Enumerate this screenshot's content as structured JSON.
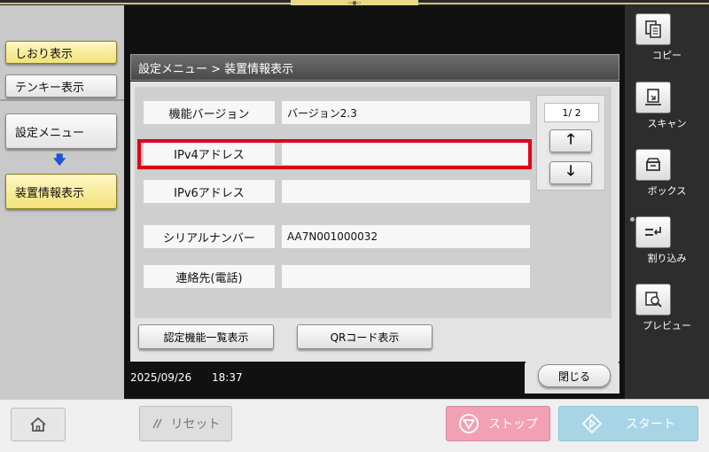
{
  "top_handle": "‹‹●››",
  "left_panel": {
    "bookmark_label": "しおり表示",
    "tenkey_label": "テンキー表示",
    "settings_menu_label": "設定メニュー",
    "device_info_label": "装置情報表示"
  },
  "dialog": {
    "breadcrumb": "設定メニュー > 装置情報表示",
    "rows": [
      {
        "label": "機能バージョン",
        "value": "バージョン2.3"
      },
      {
        "label": "IPv4アドレス",
        "value": ""
      },
      {
        "label": "IPv6アドレス",
        "value": ""
      },
      {
        "label": "シリアルナンバー",
        "value": "AA7N001000032"
      },
      {
        "label": "連絡先(電話)",
        "value": ""
      }
    ],
    "page_indicator": "1/ 2",
    "up_arrow": "🡑",
    "down_arrow": "🡓",
    "cert_list_button": "認定機能一覧表示",
    "qr_button": "QRコード表示",
    "close_button": "閉じる"
  },
  "status": {
    "date": "2025/09/26",
    "time": "18:37"
  },
  "right_panel": {
    "copy_label": "コピー",
    "scan_label": "スキャン",
    "box_label": "ボックス",
    "interrupt_label": "割り込み",
    "preview_label": "プレビュー"
  },
  "bottom_bar": {
    "reset_label": "リセット",
    "stop_label": "ストップ",
    "start_label": "スタート"
  },
  "colors": {
    "highlight": "#e0001a",
    "active_tab": "#f2e27a",
    "stop": "#f1a1b3",
    "start": "#a7d5e6"
  }
}
